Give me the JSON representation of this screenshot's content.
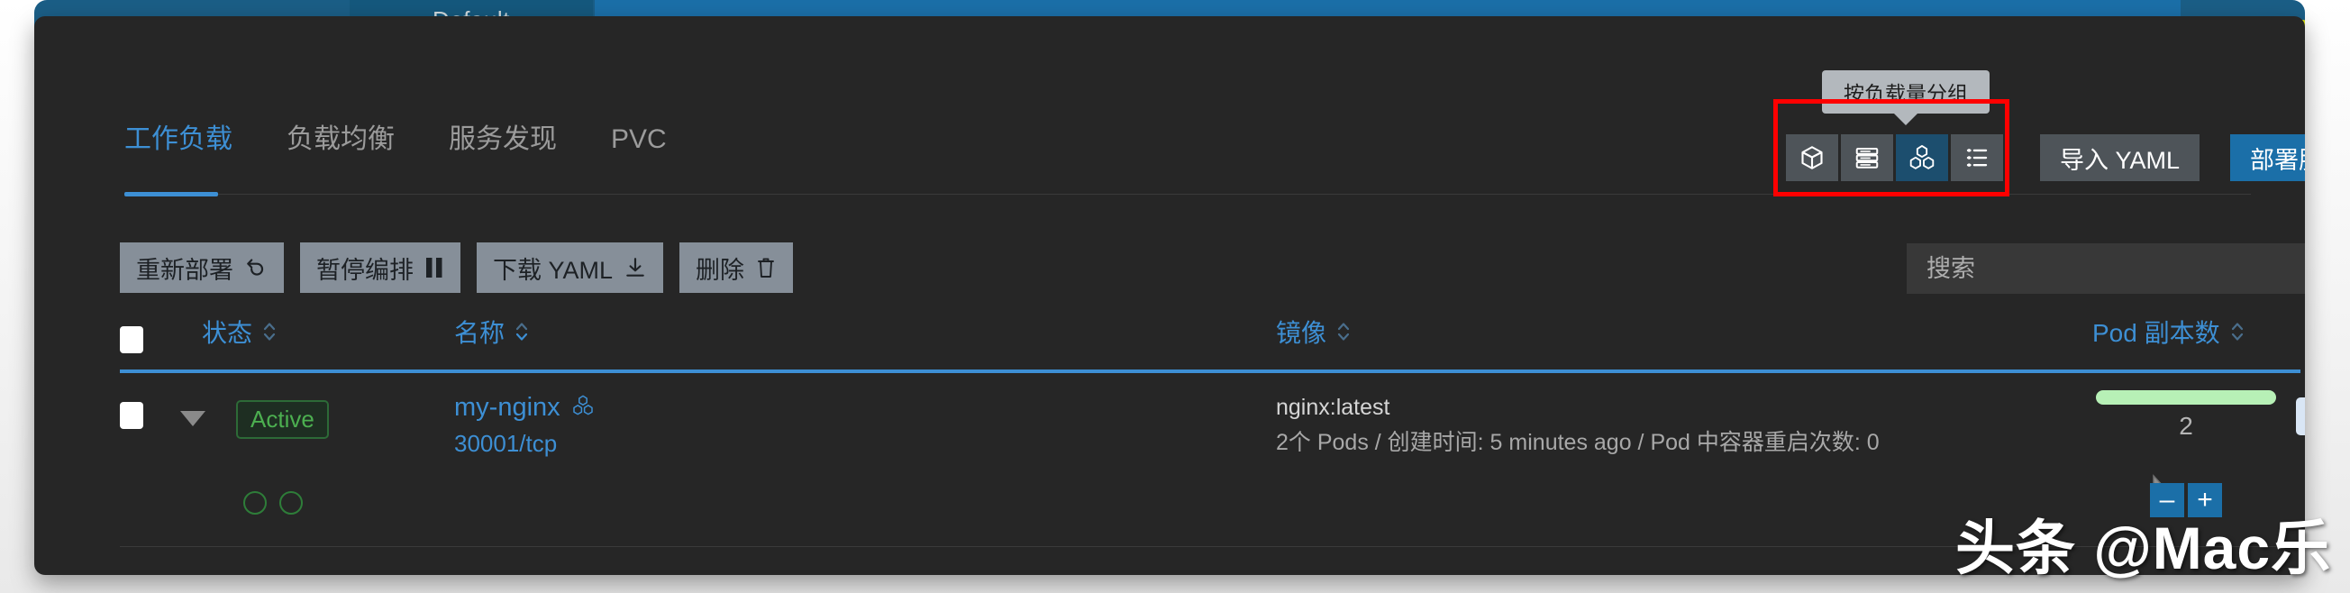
{
  "colors": {
    "panel_bg": "#262626",
    "accent_blue": "#3d8fd4",
    "deploy_blue": "#1b6fa8",
    "active_icon_bg": "#1c4e6e",
    "button_gray": "#868f99",
    "icon_gray": "#4e5459",
    "badge_green": "#4caf50",
    "replica_bar_green": "#b7f0b6",
    "annotation_red": "#ff0000",
    "tooltip_bg": "#b3b8bd"
  },
  "top_strip": {
    "namespace_tab": "Default",
    "tab_pill_1": "",
    "tab_pill_2": "",
    "yellow_button": "",
    "lime_button": ""
  },
  "tabs": [
    {
      "label": "工作负载",
      "active": true,
      "name": "tab-workloads"
    },
    {
      "label": "负载均衡",
      "active": false,
      "name": "tab-load-balancing"
    },
    {
      "label": "服务发现",
      "active": false,
      "name": "tab-service-discovery"
    },
    {
      "label": "PVC",
      "active": false,
      "name": "tab-pvc"
    }
  ],
  "view_toolbar": {
    "tooltip": "按负载量分组",
    "icons": [
      {
        "name": "cube-icon",
        "active": false
      },
      {
        "name": "server-stack-icon",
        "active": false
      },
      {
        "name": "workload-group-icon",
        "active": true
      },
      {
        "name": "list-view-icon",
        "active": false
      }
    ],
    "import_yaml_label": "导入 YAML",
    "deploy_service_label": "部署服务"
  },
  "actions": [
    {
      "label": "重新部署",
      "icon": "↻",
      "name": "redeploy-button"
    },
    {
      "label": "暂停编排",
      "icon": "⏸",
      "name": "pause-orchestration-button"
    },
    {
      "label": "下载 YAML",
      "icon": "⤓",
      "name": "download-yaml-button"
    },
    {
      "label": "删除",
      "icon": "🗑",
      "name": "delete-button"
    }
  ],
  "search": {
    "placeholder": "搜索",
    "value": ""
  },
  "table": {
    "headers": {
      "status": "状态",
      "name": "名称",
      "image": "镜像",
      "replicas": "Pod 副本数"
    },
    "rows": [
      {
        "status_badge": "Active",
        "name": "my-nginx",
        "port": "30001/tcp",
        "image": "nginx:latest",
        "image_detail": "2个 Pods / 创建时间: 5 minutes ago / Pod 中容器重启次数: 0",
        "replica_count": "2",
        "pod_dots": 2
      }
    ]
  },
  "stepper": {
    "minus": "–",
    "plus": "+"
  },
  "watermark": "头条 @Mac乐"
}
